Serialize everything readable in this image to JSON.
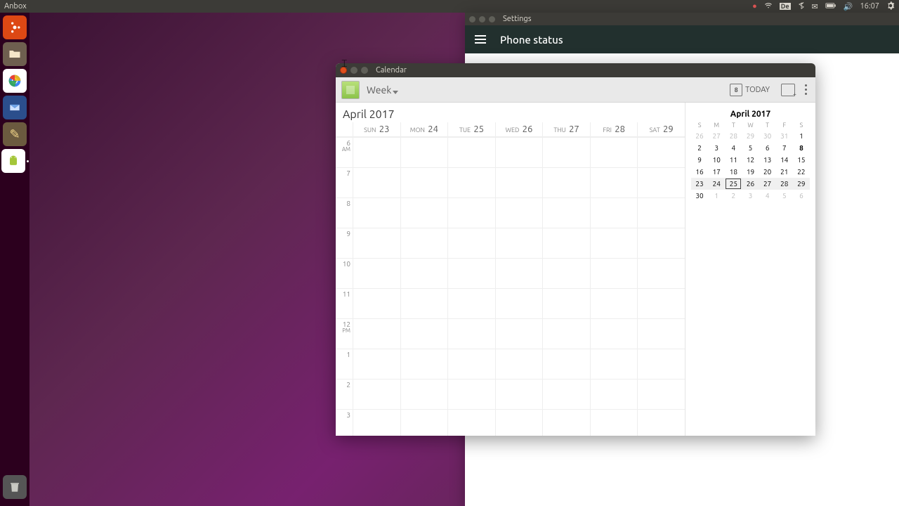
{
  "menubar": {
    "app_name": "Anbox",
    "lang": "De",
    "time": "16:07"
  },
  "settings_window": {
    "title": "Settings",
    "page_title": "Phone status"
  },
  "calendar_window": {
    "title": "Calendar",
    "view": "Week",
    "today_button": "TODAY",
    "today_marker_day": "8",
    "month_title": "April 2017",
    "week_days": [
      {
        "dow": "SUN",
        "num": "23"
      },
      {
        "dow": "MON",
        "num": "24"
      },
      {
        "dow": "TUE",
        "num": "25"
      },
      {
        "dow": "WED",
        "num": "26"
      },
      {
        "dow": "THU",
        "num": "27"
      },
      {
        "dow": "FRI",
        "num": "28"
      },
      {
        "dow": "SAT",
        "num": "29"
      }
    ],
    "hours": [
      {
        "label": "6",
        "ampm": "AM"
      },
      {
        "label": "7",
        "ampm": ""
      },
      {
        "label": "8",
        "ampm": ""
      },
      {
        "label": "9",
        "ampm": ""
      },
      {
        "label": "10",
        "ampm": ""
      },
      {
        "label": "11",
        "ampm": ""
      },
      {
        "label": "12",
        "ampm": "PM"
      },
      {
        "label": "1",
        "ampm": ""
      },
      {
        "label": "2",
        "ampm": ""
      },
      {
        "label": "3",
        "ampm": ""
      }
    ],
    "mini": {
      "title": "April 2017",
      "dow": [
        "S",
        "M",
        "T",
        "W",
        "T",
        "F",
        "S"
      ],
      "rows": [
        {
          "days": [
            "26",
            "27",
            "28",
            "29",
            "30",
            "31",
            "1"
          ],
          "classes": [
            "other",
            "other",
            "other",
            "other",
            "other",
            "other",
            ""
          ]
        },
        {
          "days": [
            "2",
            "3",
            "4",
            "5",
            "6",
            "7",
            "8"
          ],
          "classes": [
            "",
            "",
            "",
            "",
            "",
            "",
            "today"
          ]
        },
        {
          "days": [
            "9",
            "10",
            "11",
            "12",
            "13",
            "14",
            "15"
          ],
          "classes": [
            "",
            "",
            "",
            "",
            "",
            "",
            ""
          ]
        },
        {
          "days": [
            "16",
            "17",
            "18",
            "19",
            "20",
            "21",
            "22"
          ],
          "classes": [
            "",
            "",
            "",
            "",
            "",
            "",
            ""
          ]
        },
        {
          "days": [
            "23",
            "24",
            "25",
            "26",
            "27",
            "28",
            "29"
          ],
          "classes": [
            "",
            "",
            "selected",
            "",
            "",
            "",
            ""
          ],
          "current": true
        },
        {
          "days": [
            "30",
            "1",
            "2",
            "3",
            "4",
            "5",
            "6"
          ],
          "classes": [
            "",
            "other",
            "other",
            "other",
            "other",
            "other",
            "other"
          ]
        }
      ]
    }
  }
}
